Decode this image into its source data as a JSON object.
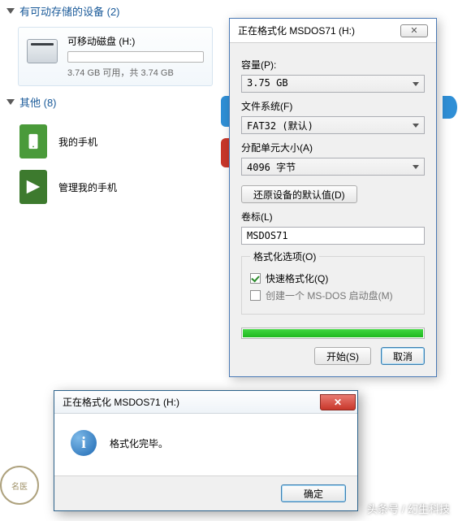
{
  "sections": {
    "removable": {
      "title": "有可动存储的设备 (2)"
    },
    "other": {
      "title": "其他 (8)"
    }
  },
  "drive": {
    "name": "可移动磁盘 (H:)",
    "capacity_text": "3.74 GB 可用，共 3.74 GB"
  },
  "phones": {
    "item1": "我的手机",
    "item2": "管理我的手机"
  },
  "fmt": {
    "title": "正在格式化 MSDOS71 (H:)",
    "close": "✕",
    "capacity_lbl": "容量(P):",
    "capacity_val": "3.75 GB",
    "fs_lbl": "文件系统(F)",
    "fs_val": "FAT32 (默认)",
    "au_lbl": "分配单元大小(A)",
    "au_val": "4096 字节",
    "restore_btn": "还原设备的默认值(D)",
    "vol_lbl": "卷标(L)",
    "vol_val": "MSDOS71",
    "opts_lbl": "格式化选项(O)",
    "quick": "快速格式化(Q)",
    "msdos": "创建一个 MS-DOS 启动盘(M)",
    "start": "开始(S)",
    "cancel": "取消"
  },
  "msg": {
    "title": "正在格式化 MSDOS71 (H:)",
    "text": "格式化完毕。",
    "ok": "确定"
  },
  "watermark": "头条号 / 幻生科技",
  "stamp": "名医"
}
